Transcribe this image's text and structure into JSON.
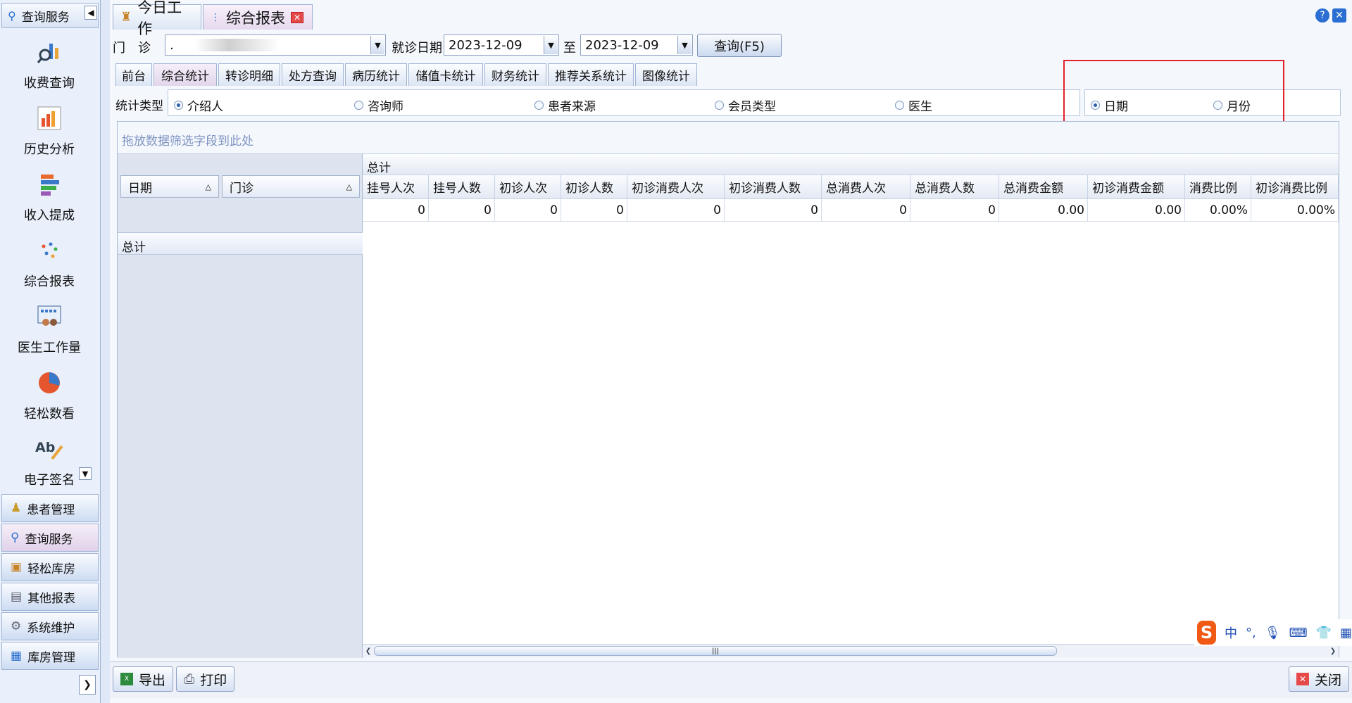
{
  "sidebar": {
    "header_label": "查询服务",
    "items": [
      {
        "label": "收费查询",
        "icon": "search-chart-icon"
      },
      {
        "label": "历史分析",
        "icon": "bar-chart-icon"
      },
      {
        "label": "收入提成",
        "icon": "stacked-bars-icon"
      },
      {
        "label": "综合报表",
        "icon": "dots-icon"
      },
      {
        "label": "医生工作量",
        "icon": "doctor-board-icon"
      },
      {
        "label": "轻松数看",
        "icon": "pie-chart-icon"
      },
      {
        "label": "电子签名",
        "icon": "signature-icon"
      }
    ],
    "groups": [
      {
        "label": "患者管理",
        "icon": "people-icon"
      },
      {
        "label": "查询服务",
        "icon": "magnifier-icon"
      },
      {
        "label": "轻松库房",
        "icon": "box-icon"
      },
      {
        "label": "其他报表",
        "icon": "report-icon"
      },
      {
        "label": "系统维护",
        "icon": "gears-icon"
      },
      {
        "label": "库房管理",
        "icon": "warehouse-icon"
      }
    ],
    "active_group": "查询服务"
  },
  "tabs": [
    {
      "label": "今日工作",
      "icon": "home-icon"
    },
    {
      "label": "综合报表",
      "icon": "dots-icon",
      "closable": true
    }
  ],
  "toolbar": {
    "clinic_label": "门　诊",
    "clinic_value": ".",
    "date_label": "就诊日期",
    "date_from": "2023-12-09",
    "to_label": "至",
    "date_to": "2023-12-09",
    "query_button": "查询(F5)"
  },
  "subtabs": [
    "前台",
    "综合统计",
    "转诊明细",
    "处方查询",
    "病历统计",
    "储值卡统计",
    "财务统计",
    "推荐关系统计",
    "图像统计"
  ],
  "active_subtab": "综合统计",
  "stat_type": {
    "label": "统计类型",
    "options": [
      "介绍人",
      "咨询师",
      "患者来源",
      "会员类型",
      "医生"
    ],
    "selected": "介绍人",
    "period_options": [
      "日期",
      "月份"
    ],
    "period_selected": "日期"
  },
  "pivot": {
    "filter_hint": "拖放数据筛选字段到此处",
    "row_fields": [
      "日期",
      "门诊"
    ],
    "row_total_label": "总计",
    "column_group_label": "总计",
    "columns": [
      "挂号人次",
      "挂号人数",
      "初诊人次",
      "初诊人数",
      "初诊消费人次",
      "初诊消费人数",
      "总消费人次",
      "总消费人数",
      "总消费金额",
      "初诊消费金额",
      "消费比例",
      "初诊消费比例"
    ],
    "values": [
      "0",
      "0",
      "0",
      "0",
      "0",
      "0",
      "0",
      "0",
      "0.00",
      "0.00",
      "0.00%",
      "0.00%"
    ]
  },
  "bottom": {
    "export_label": "导出",
    "print_label": "打印",
    "close_label": "关闭"
  },
  "ime": {
    "lang": "中",
    "punct": "°,"
  },
  "colors": {
    "highlight_box": "#e0242a",
    "accent": "#2a6fd1"
  }
}
